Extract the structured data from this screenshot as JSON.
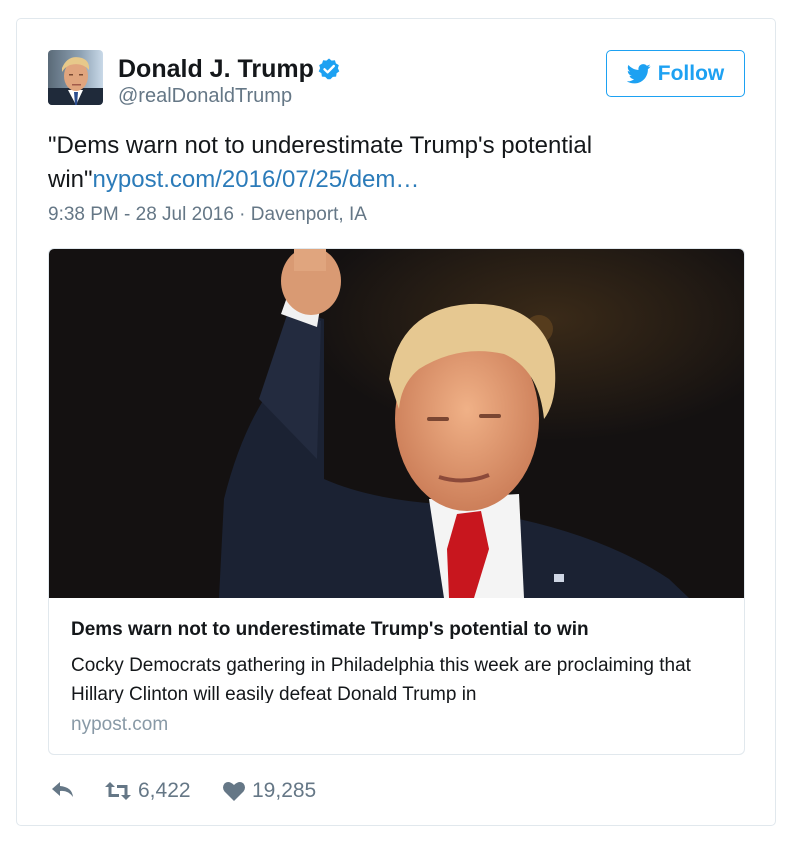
{
  "author": {
    "name": "Donald J. Trump",
    "handle": "@realDonaldTrump",
    "verified": true
  },
  "follow_button": {
    "label": "Follow",
    "icon": "twitter-bird-icon",
    "color": "#1da1f2"
  },
  "tweet": {
    "text": "\"Dems warn not to underestimate Trump's potential win\"",
    "link_text": "nypost.com/2016/07/25/dem…",
    "meta": "9:38 PM - 28 Jul 2016 · Davenport, IA"
  },
  "link_card": {
    "title": "Dems warn not to underestimate Trump's potential to win",
    "description": "Cocky Democrats gathering in Philadelphia this week are proclaiming that Hillary Clinton will easily defeat Donald Trump in",
    "domain": "nypost.com"
  },
  "actions": {
    "reply_icon": "reply-icon",
    "retweet_icon": "retweet-icon",
    "retweet_count": "6,422",
    "like_icon": "heart-icon",
    "like_count": "19,285"
  },
  "colors": {
    "link": "#2b7bb9",
    "muted": "#657786",
    "border": "#e1e8ed",
    "verified": "#1da1f2"
  }
}
